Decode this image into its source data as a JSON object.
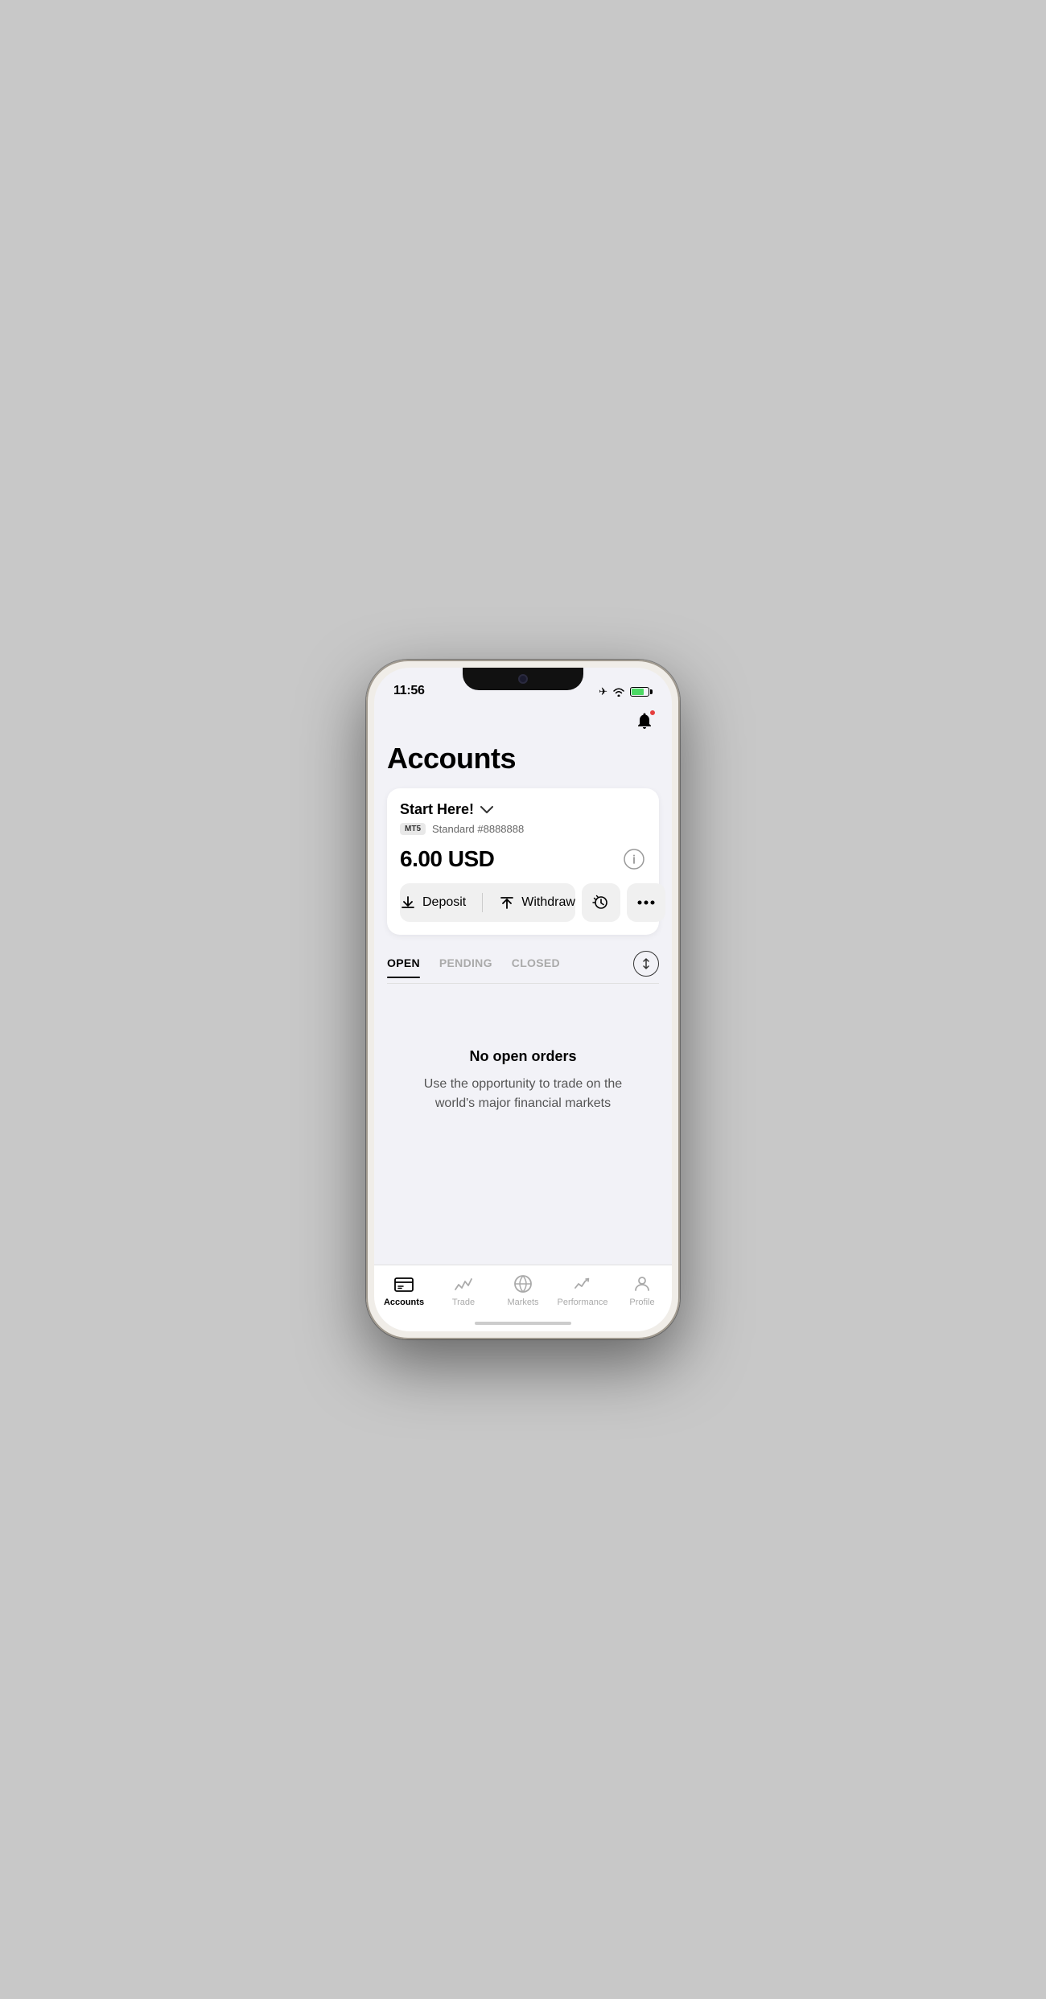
{
  "status_bar": {
    "time": "11:56"
  },
  "header": {
    "title": "Accounts"
  },
  "account": {
    "name": "Start Here!",
    "badge": "MT5",
    "account_number": "Standard #8888888",
    "balance": "6.00 USD",
    "deposit_label": "Deposit",
    "withdraw_label": "Withdraw"
  },
  "tabs": {
    "open_label": "OPEN",
    "pending_label": "PENDING",
    "closed_label": "CLOSED",
    "active": "OPEN"
  },
  "empty_state": {
    "title": "No open orders",
    "description": "Use the opportunity to trade on the world's major financial markets"
  },
  "bottom_nav": {
    "items": [
      {
        "id": "accounts",
        "label": "Accounts",
        "active": true
      },
      {
        "id": "trade",
        "label": "Trade",
        "active": false
      },
      {
        "id": "markets",
        "label": "Markets",
        "active": false
      },
      {
        "id": "performance",
        "label": "Performance",
        "active": false
      },
      {
        "id": "profile",
        "label": "Profile",
        "active": false
      }
    ]
  }
}
